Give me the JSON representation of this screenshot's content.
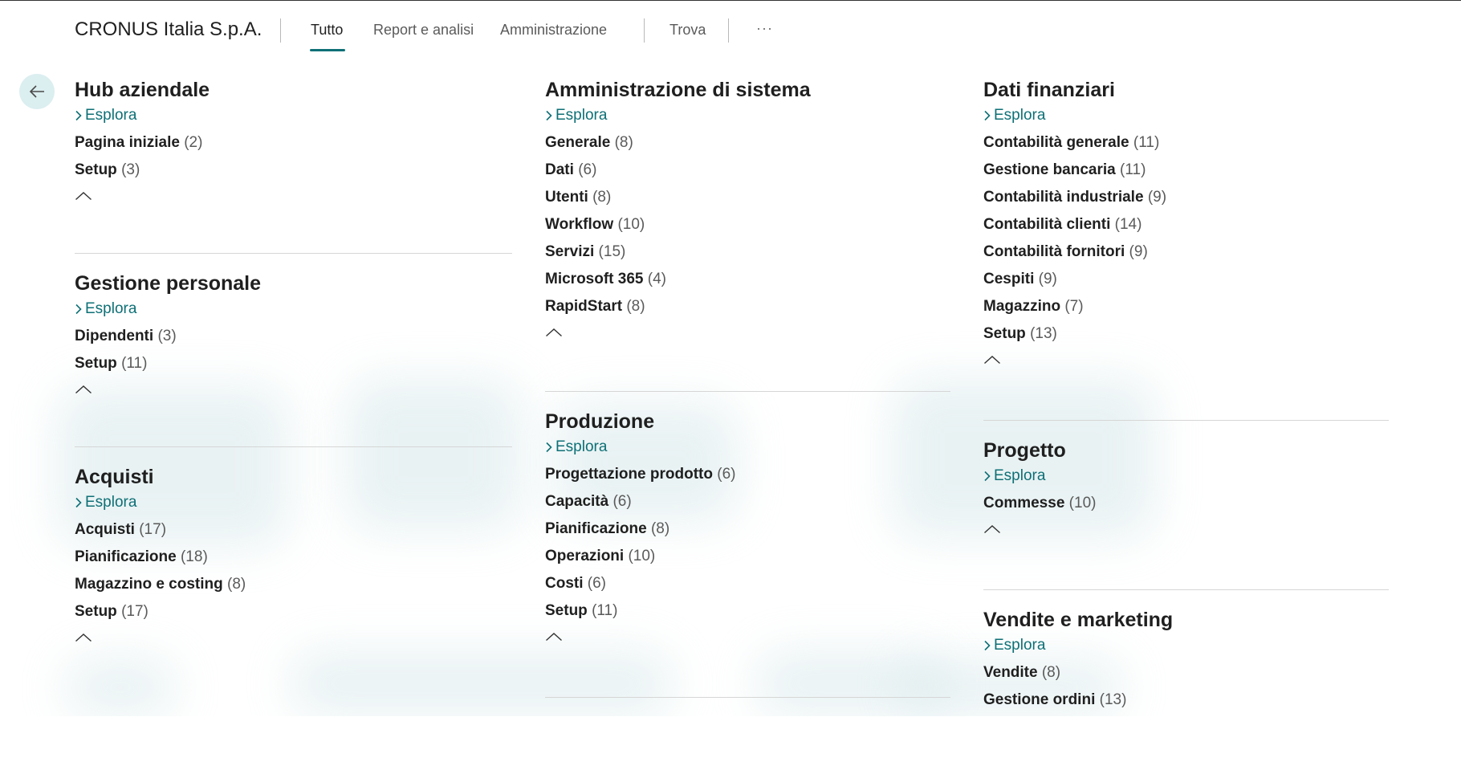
{
  "header": {
    "company": "CRONUS Italia S.p.A.",
    "tabs": [
      {
        "label": "Tutto"
      },
      {
        "label": "Report e analisi"
      },
      {
        "label": "Amministrazione"
      }
    ],
    "find_label": "Trova",
    "more_label": "···"
  },
  "explore_label": "Esplora",
  "columns": [
    {
      "groups": [
        {
          "title": "Hub aziendale",
          "items": [
            {
              "name": "Pagina iniziale",
              "count": "(2)"
            },
            {
              "name": "Setup",
              "count": "(3)"
            }
          ]
        },
        {
          "title": "Gestione personale",
          "items": [
            {
              "name": "Dipendenti",
              "count": "(3)"
            },
            {
              "name": "Setup",
              "count": "(11)"
            }
          ]
        },
        {
          "title": "Acquisti",
          "items": [
            {
              "name": "Acquisti",
              "count": "(17)"
            },
            {
              "name": "Pianificazione",
              "count": "(18)"
            },
            {
              "name": "Magazzino e costing",
              "count": "(8)"
            },
            {
              "name": "Setup",
              "count": "(17)"
            }
          ]
        }
      ]
    },
    {
      "groups": [
        {
          "title": "Amministrazione di sistema",
          "items": [
            {
              "name": "Generale",
              "count": "(8)"
            },
            {
              "name": "Dati",
              "count": "(6)"
            },
            {
              "name": "Utenti",
              "count": "(8)"
            },
            {
              "name": "Workflow",
              "count": "(10)"
            },
            {
              "name": "Servizi",
              "count": "(15)"
            },
            {
              "name": "Microsoft 365",
              "count": "(4)"
            },
            {
              "name": "RapidStart",
              "count": "(8)"
            }
          ]
        },
        {
          "title": "Produzione",
          "items": [
            {
              "name": "Progettazione prodotto",
              "count": "(6)"
            },
            {
              "name": "Capacità",
              "count": "(6)"
            },
            {
              "name": "Pianificazione",
              "count": "(8)"
            },
            {
              "name": "Operazioni",
              "count": "(10)"
            },
            {
              "name": "Costi",
              "count": "(6)"
            },
            {
              "name": "Setup",
              "count": "(11)"
            }
          ]
        }
      ]
    },
    {
      "groups": [
        {
          "title": "Dati finanziari",
          "items": [
            {
              "name": "Contabilità generale",
              "count": "(11)"
            },
            {
              "name": "Gestione bancaria",
              "count": "(11)"
            },
            {
              "name": "Contabilità industriale",
              "count": "(9)"
            },
            {
              "name": "Contabilità clienti",
              "count": "(14)"
            },
            {
              "name": "Contabilità fornitori",
              "count": "(9)"
            },
            {
              "name": "Cespiti",
              "count": "(9)"
            },
            {
              "name": "Magazzino",
              "count": "(7)"
            },
            {
              "name": "Setup",
              "count": "(13)"
            }
          ]
        },
        {
          "title": "Progetto",
          "items": [
            {
              "name": "Commesse",
              "count": "(10)"
            }
          ]
        },
        {
          "title": "Vendite e marketing",
          "items": [
            {
              "name": "Vendite",
              "count": "(8)"
            },
            {
              "name": "Gestione ordini",
              "count": "(13)"
            }
          ]
        }
      ]
    }
  ],
  "colors": {
    "accent": "#0e7076",
    "back_button_bg": "#dbeef0"
  }
}
